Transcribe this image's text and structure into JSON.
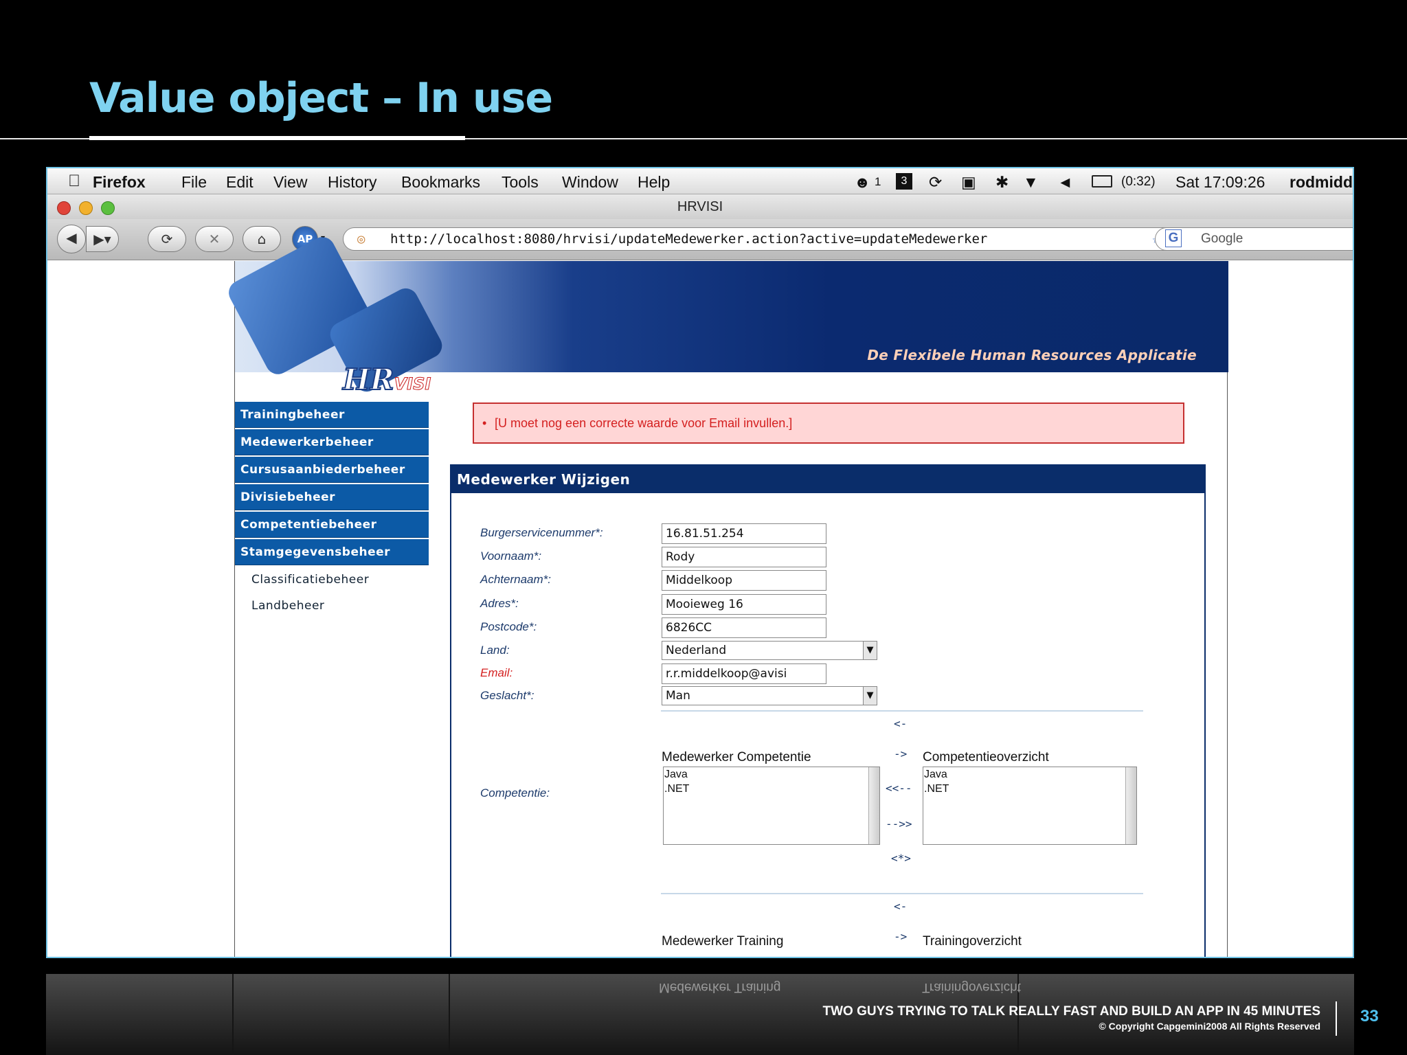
{
  "slide": {
    "title": "Value object – In use",
    "footer_main": "TWO GUYS TRYING TO TALK REALLY FAST AND BUILD AN APP IN 45 MINUTES",
    "footer_copyright": "© Copyright Capgemini2008 All Rights Reserved",
    "page_number": "33"
  },
  "menubar": {
    "app": "Firefox",
    "items": [
      "File",
      "Edit",
      "View",
      "History",
      "Bookmarks",
      "Tools",
      "Window",
      "Help"
    ],
    "notification_count": "1",
    "calendar_day": "3",
    "battery": "(0:32)",
    "clock": "Sat 17:09:26",
    "user": "rodmidd"
  },
  "window": {
    "title": "HRVISI"
  },
  "toolbar": {
    "url": "http://localhost:8080/hrvisi/updateMedewerker.action?active=updateMedewerker",
    "search_placeholder": "Google"
  },
  "app": {
    "tagline": "De Flexibele Human Resources Applicatie",
    "logo_main": "HR",
    "logo_sub": "VISI",
    "nav": [
      "Trainingbeheer",
      "Medewerkerbeheer",
      "Cursusaanbiederbeheer",
      "Divisiebeheer",
      "Competentiebeheer",
      "Stamgegevensbeheer"
    ],
    "subnav": [
      "Classificatiebeheer",
      "Landbeheer"
    ],
    "error": "[U moet nog een correcte waarde voor Email invullen.]",
    "panel_title": "Medewerker Wijzigen",
    "form": {
      "bsn": {
        "label": "Burgerservicenummer*:",
        "value": "16.81.51.254"
      },
      "voornaam": {
        "label": "Voornaam*:",
        "value": "Rody"
      },
      "achternaam": {
        "label": "Achternaam*:",
        "value": "Middelkoop"
      },
      "adres": {
        "label": "Adres*:",
        "value": "Mooieweg 16"
      },
      "postcode": {
        "label": "Postcode*:",
        "value": "6826CC"
      },
      "land": {
        "label": "Land:",
        "value": "Nederland"
      },
      "email": {
        "label": "Email:",
        "value": "r.r.middelkoop@avisi"
      },
      "geslacht": {
        "label": "Geslacht*:",
        "value": "Man"
      }
    },
    "competentie": {
      "label": "Competentie:",
      "left_title": "Medewerker Competentie",
      "right_title": "Competentieoverzicht",
      "left_items": [
        "Java",
        ".NET"
      ],
      "right_items": [
        "Java",
        ".NET"
      ],
      "btn_up": "<-",
      "btn_right": "->",
      "btn_all_left": "<<--",
      "btn_all_right": "-->>",
      "btn_swap": "<*>"
    },
    "training": {
      "btn_up": "<-",
      "btn_right": "->",
      "left_title": "Medewerker Training",
      "right_title": "Trainingoverzicht"
    }
  }
}
